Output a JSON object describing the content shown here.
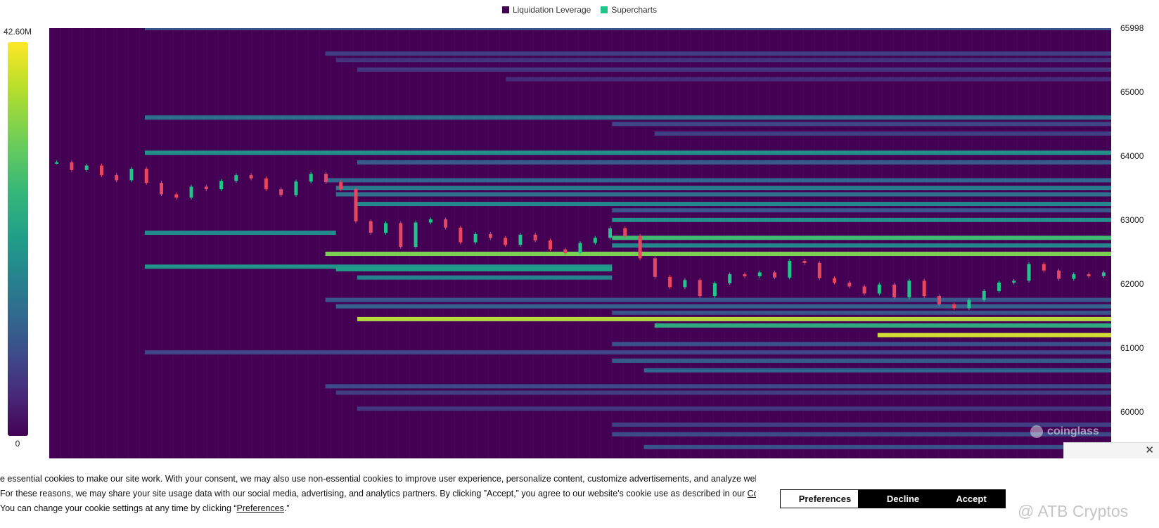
{
  "legend": [
    {
      "label": "Liquidation Leverage",
      "color": "#440154"
    },
    {
      "label": "Supercharts",
      "color": "#22c48a"
    }
  ],
  "color_scale": {
    "max": "42.60M",
    "min": "0"
  },
  "watermark": "coinglass",
  "cookie": {
    "line1": "e essential cookies to make our site work. With your consent, we may also use non-essential cookies to improve user experience, personalize content, customize advertisements, and analyze website",
    "line2_before": "For these reasons, we may share your site usage data with our social media, advertising, and analytics partners. By clicking ”Accept,” you agree to our website's cookie use as described in our ",
    "line2_link": "Cookie",
    "line3_before": "You can change your cookie settings at any time by clicking “",
    "line3_link": "Preferences",
    "line3_after": ".”",
    "preferences_label": "Preferences",
    "decline_label": "Decline",
    "accept_label": "Accept",
    "close_icon": "✕"
  },
  "source_credit": "@ ATB Cryptos",
  "chart_data": {
    "type": "heatmap",
    "title": "",
    "xlabel": "",
    "ylabel": "",
    "y_ticks": [
      65998,
      65000,
      64000,
      63000,
      62000,
      61000,
      60000
    ],
    "ylim": [
      59290,
      65998
    ],
    "colorscale": "viridis",
    "zlim": [
      0,
      42600000
    ],
    "legend_position": "top-center",
    "price_series": [
      63900,
      63780,
      63850,
      63700,
      63620,
      63800,
      63580,
      63400,
      63350,
      63520,
      63480,
      63610,
      63700,
      63650,
      63480,
      63390,
      63600,
      63720,
      63590,
      63480,
      62980,
      62800,
      62950,
      62580,
      62960,
      63010,
      62880,
      62650,
      62780,
      62720,
      62610,
      62770,
      62680,
      62540,
      62480,
      62640,
      62720,
      62870,
      62750,
      62400,
      62110,
      61950,
      62060,
      61810,
      62010,
      62150,
      62120,
      62180,
      62100,
      62360,
      62330,
      62090,
      62020,
      61960,
      61850,
      61990,
      61790,
      62050,
      61810,
      61680,
      61620,
      61750,
      61890,
      62020,
      62050,
      62310,
      62210,
      62080,
      62150,
      62120,
      62180
    ],
    "liquidation_bands": [
      {
        "price": 65998,
        "start": 0.09,
        "end": 1.0,
        "value": 12000000
      },
      {
        "price": 65600,
        "start": 0.26,
        "end": 1.0,
        "value": 9000000
      },
      {
        "price": 65500,
        "start": 0.27,
        "end": 1.0,
        "value": 7000000
      },
      {
        "price": 65350,
        "start": 0.29,
        "end": 1.0,
        "value": 8000000
      },
      {
        "price": 65200,
        "start": 0.43,
        "end": 1.0,
        "value": 6000000
      },
      {
        "price": 64600,
        "start": 0.09,
        "end": 1.0,
        "value": 18000000
      },
      {
        "price": 64500,
        "start": 0.53,
        "end": 1.0,
        "value": 10000000
      },
      {
        "price": 64350,
        "start": 0.57,
        "end": 1.0,
        "value": 9000000
      },
      {
        "price": 64050,
        "start": 0.09,
        "end": 1.0,
        "value": 24000000
      },
      {
        "price": 63900,
        "start": 0.29,
        "end": 1.0,
        "value": 14000000
      },
      {
        "price": 63620,
        "start": 0.26,
        "end": 1.0,
        "value": 16000000
      },
      {
        "price": 63500,
        "start": 0.27,
        "end": 1.0,
        "value": 20000000
      },
      {
        "price": 63400,
        "start": 0.27,
        "end": 1.0,
        "value": 18000000
      },
      {
        "price": 63250,
        "start": 0.29,
        "end": 1.0,
        "value": 22000000
      },
      {
        "price": 63150,
        "start": 0.53,
        "end": 1.0,
        "value": 13000000
      },
      {
        "price": 63000,
        "start": 0.53,
        "end": 1.0,
        "value": 24000000
      },
      {
        "price": 62800,
        "start": 0.09,
        "end": 0.27,
        "value": 23000000
      },
      {
        "price": 62720,
        "start": 0.53,
        "end": 1.0,
        "value": 33000000
      },
      {
        "price": 62600,
        "start": 0.53,
        "end": 1.0,
        "value": 22000000
      },
      {
        "price": 62470,
        "start": 0.26,
        "end": 1.0,
        "value": 38000000
      },
      {
        "price": 62270,
        "start": 0.09,
        "end": 0.53,
        "value": 25000000
      },
      {
        "price": 62230,
        "start": 0.27,
        "end": 0.53,
        "value": 27000000
      },
      {
        "price": 62100,
        "start": 0.29,
        "end": 0.53,
        "value": 21000000
      },
      {
        "price": 61750,
        "start": 0.26,
        "end": 1.0,
        "value": 13000000
      },
      {
        "price": 61650,
        "start": 0.27,
        "end": 1.0,
        "value": 15000000
      },
      {
        "price": 61550,
        "start": 0.53,
        "end": 1.0,
        "value": 12000000
      },
      {
        "price": 61450,
        "start": 0.29,
        "end": 1.0,
        "value": 40000000
      },
      {
        "price": 61350,
        "start": 0.57,
        "end": 1.0,
        "value": 30000000
      },
      {
        "price": 61200,
        "start": 0.78,
        "end": 1.0,
        "value": 41000000
      },
      {
        "price": 61060,
        "start": 0.53,
        "end": 1.0,
        "value": 12000000
      },
      {
        "price": 60930,
        "start": 0.09,
        "end": 1.0,
        "value": 10000000
      },
      {
        "price": 60800,
        "start": 0.53,
        "end": 1.0,
        "value": 14000000
      },
      {
        "price": 60650,
        "start": 0.56,
        "end": 1.0,
        "value": 16000000
      },
      {
        "price": 60400,
        "start": 0.26,
        "end": 1.0,
        "value": 11000000
      },
      {
        "price": 60300,
        "start": 0.27,
        "end": 1.0,
        "value": 9000000
      },
      {
        "price": 60050,
        "start": 0.29,
        "end": 1.0,
        "value": 8000000
      },
      {
        "price": 59800,
        "start": 0.53,
        "end": 1.0,
        "value": 9000000
      },
      {
        "price": 59650,
        "start": 0.53,
        "end": 1.0,
        "value": 11000000
      },
      {
        "price": 59450,
        "start": 0.56,
        "end": 1.0,
        "value": 12000000
      }
    ]
  }
}
